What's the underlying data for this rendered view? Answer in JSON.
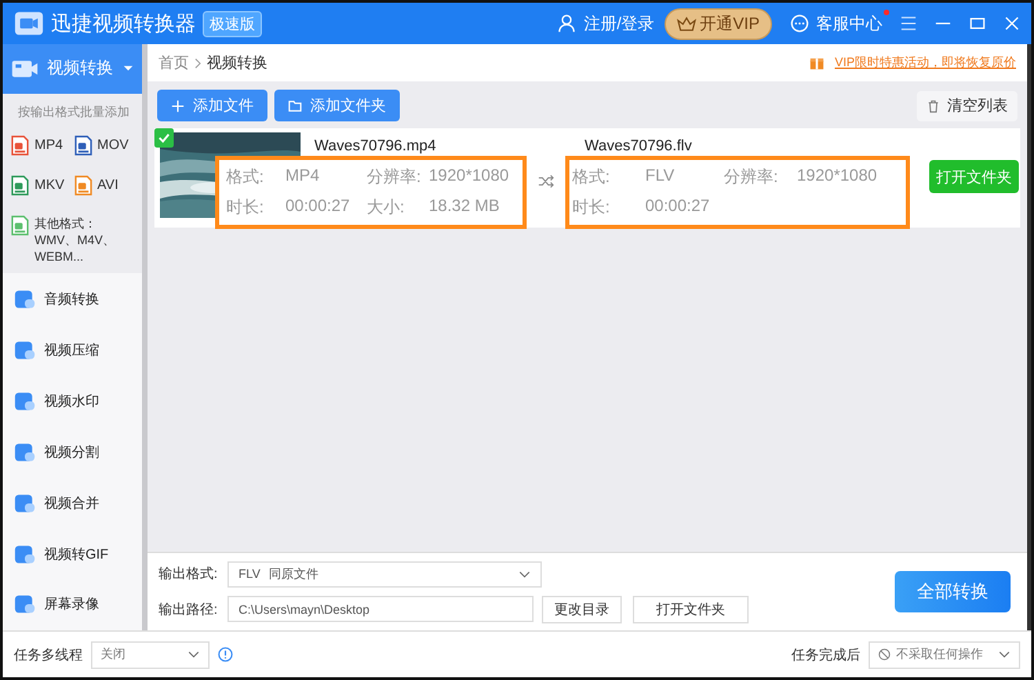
{
  "app": {
    "title": "迅捷视频转换器",
    "edition": "极速版",
    "login": "注册/登录",
    "vip": "开通VIP",
    "support": "客服中心",
    "support_unread": true
  },
  "sidebar": {
    "current": {
      "label": "视频转换",
      "expanded": true
    },
    "format_hint": "按输出格式批量添加",
    "formats": [
      {
        "label": "MP4",
        "color": "#e8533a"
      },
      {
        "label": "MOV",
        "color": "#2f5fb8"
      },
      {
        "label": "MKV",
        "color": "#2e9a5a"
      },
      {
        "label": "AVI",
        "color": "#f08a24"
      },
      {
        "label": "其他格式：WMV、M4V、WEBM...",
        "color": "#5cbf6e"
      }
    ],
    "items": [
      "音频转换",
      "视频压缩",
      "视频水印",
      "视频分割",
      "视频合并",
      "视频转GIF",
      "屏幕录像"
    ]
  },
  "breadcrumb": [
    "首页",
    "视频转换"
  ],
  "promo": "VIP限时特惠活动，即将恢复原价",
  "toolbar": {
    "add_file": "添加文件",
    "add_folder": "添加文件夹",
    "clear": "清空列表"
  },
  "files": [
    {
      "checked": true,
      "source": {
        "name": "Waves70796.mp4",
        "rows": [
          [
            "格式:",
            "MP4",
            "分辨率:",
            "1920*1080"
          ],
          [
            "时长:",
            "00:00:27",
            "大小:",
            "18.32 MB"
          ]
        ]
      },
      "target": {
        "name": "Waves70796.flv",
        "rows": [
          [
            "格式:",
            "FLV",
            "分辨率:",
            "1920*1080"
          ],
          [
            "时长:",
            "00:00:27"
          ]
        ]
      },
      "action": "打开文件夹"
    }
  ],
  "output": {
    "format_label": "输出格式:",
    "format_value": "FLV",
    "format_note": "同原文件",
    "path_label": "输出路径:",
    "path": "C:\\Users\\mayn\\Desktop",
    "change": "更改目录",
    "open": "打开文件夹",
    "convert": "全部转换"
  },
  "status": {
    "threads_label": "任务多线程",
    "threads_value": "关闭",
    "after_label": "任务完成后",
    "after_value": "不采取任何操作"
  }
}
